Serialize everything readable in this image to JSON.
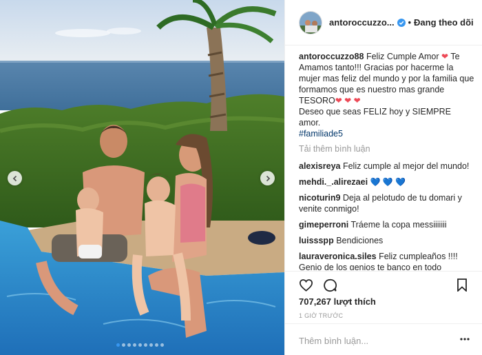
{
  "post": {
    "username": "antoroccuzzo...",
    "follow_status": "Đang theo dõi",
    "separator": "•"
  },
  "photo": {
    "slide_count": 9,
    "active_slide": 0
  },
  "caption": {
    "username": "antoroccuzzo88",
    "line1": "Feliz Cumple Amor",
    "line2": "Te Amamos tanto!!! Gracias por hacerme la mujer mas feliz del mundo y por la familia que formamos que es nuestro mas grande TESORO",
    "line3": "Deseo que seas FELIZ hoy y SIEMPRE amor.",
    "hashtag": "#familiade5"
  },
  "load_more": "Tải thêm bình luận",
  "comments": [
    {
      "user": "alexisreya",
      "text": "Feliz cumple al mejor del mundo!"
    },
    {
      "user": "mehdi._.alirezaei",
      "text": ""
    },
    {
      "user": "nicoturin9",
      "text": "Deja al pelotudo de tu domari y venite conmigo!"
    },
    {
      "user": "gimeperroni",
      "text": "Tráeme la copa messiiiiiii"
    },
    {
      "user": "luissspp",
      "text": "Bendiciones"
    },
    {
      "user": "lauraveronica.siles",
      "text": "Feliz cumpleaños !!!! Genio de los genios te banco en todo"
    }
  ],
  "likes": "707,267 lượt thích",
  "timestamp": "1 GIỜ TRƯỚC",
  "add_comment_placeholder": "Thêm bình luận...",
  "colors": {
    "heart": "#ed4956",
    "blue_heart": "#3897f0",
    "verified": "#3897f0",
    "hashtag": "#003569",
    "muted": "#999999"
  },
  "icons": [
    "chevron-left-icon",
    "chevron-right-icon",
    "verified-badge-icon",
    "heart-icon",
    "comment-icon",
    "bookmark-icon",
    "more-options-icon"
  ]
}
